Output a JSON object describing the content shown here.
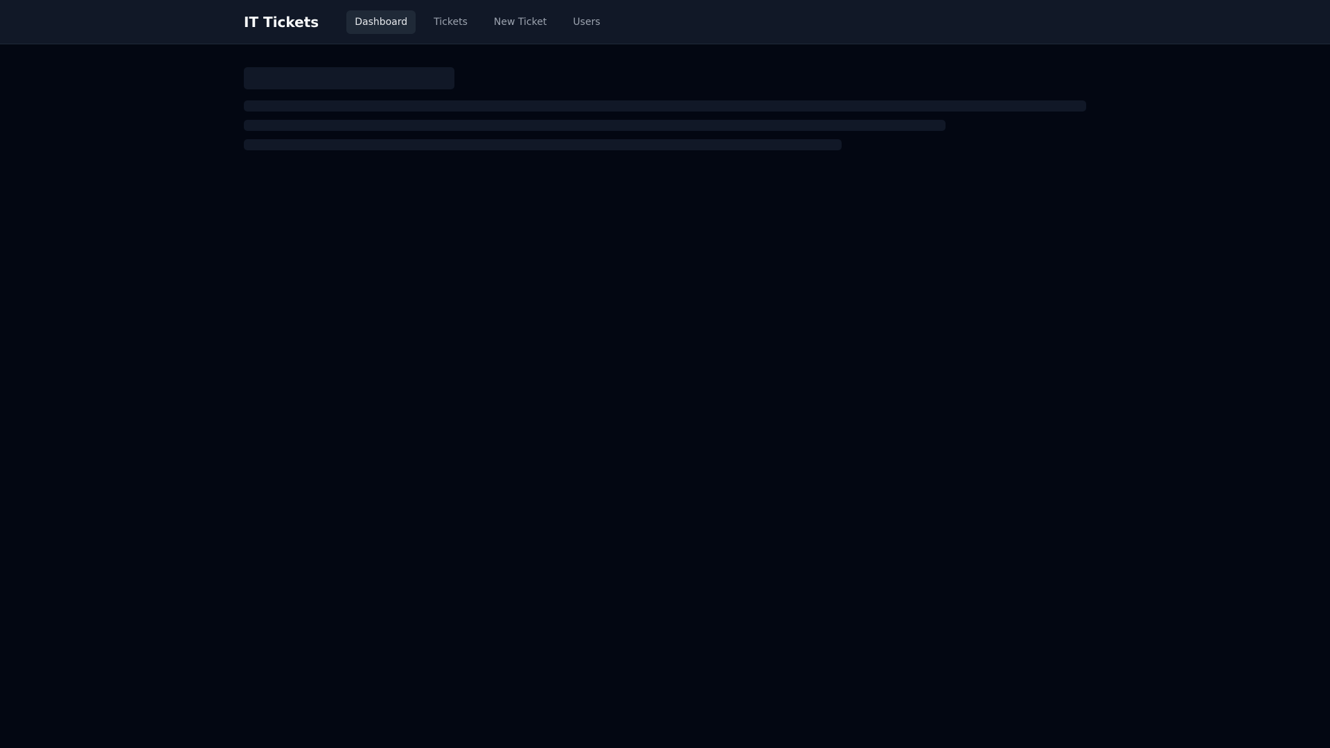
{
  "header": {
    "title": "IT Tickets",
    "nav": [
      {
        "label": "Dashboard",
        "active": true
      },
      {
        "label": "Tickets",
        "active": false
      },
      {
        "label": "New Ticket",
        "active": false
      },
      {
        "label": "Users",
        "active": false
      }
    ]
  },
  "main": {
    "loading": true,
    "skeleton_line_fractions": [
      1.0,
      0.833,
      0.71
    ]
  },
  "colors": {
    "background": "#030712",
    "header": "#111827",
    "skeleton": "#111827",
    "active_tab": "#1f2937"
  }
}
